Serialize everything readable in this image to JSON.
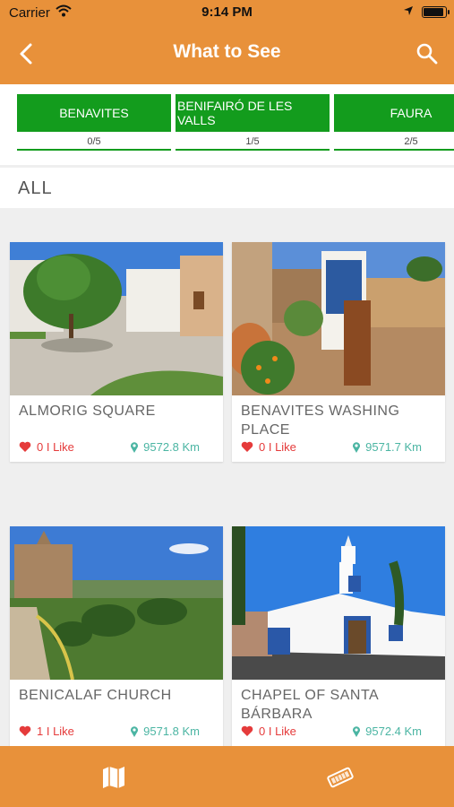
{
  "status_bar": {
    "carrier": "Carrier",
    "time": "9:14 PM"
  },
  "header": {
    "title": "What to See"
  },
  "towns": [
    {
      "name": "BENAVITES",
      "progress": "0/5"
    },
    {
      "name": "BENIFAIRÓ DE LES VALLS",
      "progress": "1/5"
    },
    {
      "name": "FAURA",
      "progress": "2/5"
    }
  ],
  "section": {
    "title": "ALL"
  },
  "places": [
    {
      "name": "ALMORIG SQUARE",
      "likes": "0 I Like",
      "distance": "9572.8 Km"
    },
    {
      "name": "BENAVITES WASHING PLACE",
      "likes": "0 I Like",
      "distance": "9571.7 Km"
    },
    {
      "name": "BENICALAF CHURCH",
      "likes": "1 I Like",
      "distance": "9571.8 Km"
    },
    {
      "name": "CHAPEL OF SANTA BÁRBARA",
      "likes": "0 I Like",
      "distance": "9572.4 Km"
    }
  ],
  "tabbar": {
    "tabs": [
      {
        "icon": "map-icon"
      },
      {
        "icon": "ticket-icon"
      }
    ]
  },
  "colors": {
    "brand": "#e8913a",
    "town_button": "#139c1d",
    "like": "#e53b3b",
    "distance": "#4bb5a3"
  }
}
